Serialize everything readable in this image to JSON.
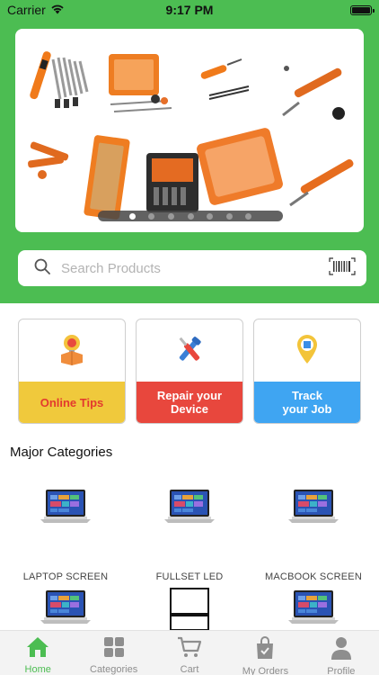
{
  "status_bar": {
    "carrier": "Carrier",
    "time": "9:17 PM"
  },
  "banner": {
    "page_count": 7,
    "active_page": 1
  },
  "search": {
    "placeholder": "Search Products"
  },
  "features": [
    {
      "label": "Online  Tips",
      "bg": "#f0c93c",
      "text_color": "#e33a2e",
      "icon": "lightbulb-box-icon"
    },
    {
      "label": "Repair your\nDevice",
      "bg": "#e8473d",
      "text_color": "#ffffff",
      "icon": "tools-icon"
    },
    {
      "label": "Track\nyour Job",
      "bg": "#3fa5f2",
      "text_color": "#ffffff",
      "icon": "location-pin-icon"
    }
  ],
  "categories_title": "Major Categories",
  "categories": [
    {
      "label": "LAPTOP SCREEN",
      "icon": "laptop-icon"
    },
    {
      "label": "FULLSET LED",
      "icon": "laptop-icon"
    },
    {
      "label": "MACBOOK SCREEN",
      "icon": "laptop-icon"
    },
    {
      "label": "",
      "icon": "laptop-icon"
    },
    {
      "label": "",
      "icon": "screen-panel-icon"
    },
    {
      "label": "",
      "icon": "laptop-icon"
    }
  ],
  "nav": [
    {
      "label": "Home",
      "icon": "home-icon",
      "active": true
    },
    {
      "label": "Categories",
      "icon": "grid-icon",
      "active": false
    },
    {
      "label": "Cart",
      "icon": "cart-icon",
      "active": false
    },
    {
      "label": "My Orders",
      "icon": "bag-icon",
      "active": false
    },
    {
      "label": "Profile",
      "icon": "person-icon",
      "active": false
    }
  ],
  "colors": {
    "brand_green": "#4cbd52",
    "nav_inactive": "#8e8e8e"
  }
}
